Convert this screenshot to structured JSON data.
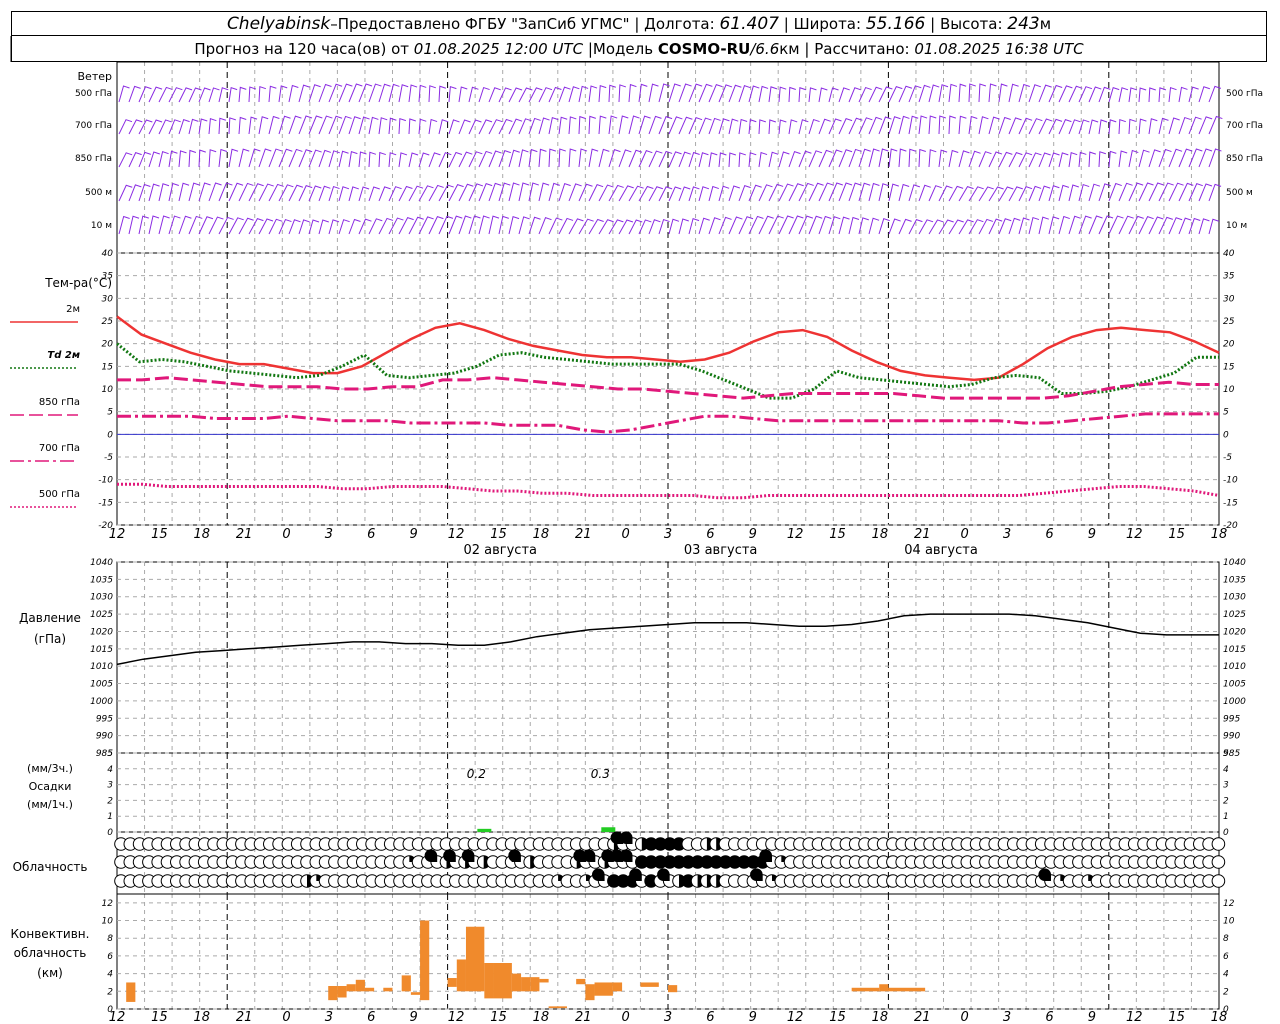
{
  "header": {
    "city": "Chelyabinsk",
    "dash": " – ",
    "provider": "Предоставлено ФГБУ \"ЗапСиб УГМС\"",
    "lon_label": "Долгота:",
    "lon": "61.407",
    "lat_label": "Широта:",
    "lat": "55.166",
    "alt_label": "Высота:",
    "alt": "243",
    "alt_unit": "м",
    "sep": "|"
  },
  "subheader": {
    "forecast_label": "Прогноз на 120 часа(ов) от",
    "issued": "01.08.2025 12:00 UTC",
    "model_label": "Модель",
    "model": "COSMO-RU",
    "slash": " / ",
    "resolution": "6.6",
    "res_unit": "км",
    "computed_label": "Рассчитано:",
    "computed": "01.08.2025 16:38 UTC"
  },
  "colors": {
    "wind": "#8a2be2",
    "t2m": "#ee3333",
    "td2m": "#117711",
    "t850": "#e0187a",
    "t700": "#e0187a",
    "t500": "#e0187a",
    "zero_line": "#3333cc",
    "pressure": "#000000",
    "precip": "#22cc22",
    "conv": "#f08a2c",
    "grid": "#aaaaaa"
  },
  "chart_data": [
    {
      "id": "wind",
      "type": "table",
      "title": "Ветер",
      "levels": [
        "500 гПа",
        "700 гПа",
        "850 гПа",
        "500 м",
        "10  м"
      ]
    },
    {
      "id": "temperature",
      "type": "line",
      "ylabel": "Тем-ра(°С)",
      "ylim": [
        -20,
        40
      ],
      "yticks": [
        -20,
        -15,
        -10,
        -5,
        0,
        5,
        10,
        15,
        20,
        25,
        30,
        35,
        40
      ],
      "x_ticks": [
        "12",
        "15",
        "18",
        "21",
        "0",
        "3",
        "6",
        "9",
        "12",
        "15",
        "18",
        "21",
        "0",
        "3",
        "6",
        "9",
        "12",
        "15",
        "18",
        "21",
        "0",
        "3",
        "6",
        "9",
        "12",
        "15",
        "18"
      ],
      "date_labels": [
        {
          "hour": 45,
          "label": "02 августа"
        },
        {
          "hour": 69,
          "label": "03 августа"
        },
        {
          "hour": 93,
          "label": "04 августа"
        }
      ],
      "x": [
        0,
        1,
        3,
        6,
        9,
        12,
        15,
        18,
        21,
        24,
        27,
        30,
        33,
        36,
        39,
        42,
        45,
        48,
        51,
        54,
        57,
        60,
        63,
        66,
        69,
        72,
        75,
        78,
        81,
        84,
        87,
        90,
        93,
        96,
        99,
        102,
        105,
        108,
        111,
        114,
        117,
        120
      ],
      "series": [
        {
          "name": "2м",
          "key": "t2m",
          "style": "solid",
          "values": [
            26,
            22,
            20,
            18,
            16.5,
            15.5,
            15.5,
            14.5,
            13.5,
            13.5,
            15,
            18,
            21,
            23.5,
            24.5,
            23,
            21,
            19.5,
            18.5,
            17.5,
            17,
            17,
            16.5,
            16,
            16.5,
            18,
            20.5,
            22.5,
            23,
            21.5,
            18.5,
            16,
            14,
            13,
            12.5,
            12,
            12.5,
            15.5,
            19,
            21.5,
            23,
            23.5,
            23,
            22.5,
            20.5,
            18
          ]
        },
        {
          "name": "Td  2м",
          "key": "td2m",
          "style": "dotted",
          "values": [
            20,
            16,
            16.5,
            16,
            15,
            14,
            13.5,
            13,
            12.5,
            13,
            15,
            17.5,
            13,
            12.5,
            13,
            13.5,
            15,
            17.5,
            18,
            17,
            16.5,
            16,
            15.5,
            15.5,
            15.5,
            15.5,
            14,
            12,
            10,
            8,
            8,
            10,
            14,
            12.5,
            12,
            11.5,
            11,
            10.5,
            11,
            12.5,
            13,
            12.5,
            9,
            9,
            9.5,
            10.5,
            12,
            13.5,
            17,
            17
          ]
        },
        {
          "name": "850 гПа",
          "key": "t850",
          "style": "longdash",
          "values": [
            12,
            12,
            12.5,
            12,
            11.5,
            11,
            10.5,
            10.5,
            10.5,
            10,
            10,
            10.5,
            10.5,
            12,
            12,
            12.5,
            12,
            11.5,
            11,
            10.5,
            10,
            10,
            9.5,
            9,
            8.5,
            8,
            8.5,
            9,
            9,
            9,
            9,
            9,
            8.5,
            8,
            8,
            8,
            8,
            8,
            8.5,
            9.5,
            10.5,
            11,
            11.5,
            11,
            11
          ]
        },
        {
          "name": "700 гПа",
          "key": "t700",
          "style": "dashdot",
          "values": [
            4,
            4,
            4,
            4,
            3.5,
            3.5,
            3.5,
            4,
            3.5,
            3,
            3,
            3,
            2.5,
            2.5,
            2.5,
            2.5,
            2,
            2,
            2,
            1,
            0.5,
            1,
            2,
            3,
            4,
            4,
            3.5,
            3,
            3,
            3,
            3,
            3,
            3,
            3,
            3,
            3,
            3,
            2.5,
            2.5,
            3,
            3.5,
            4,
            4.5,
            4.5,
            4.5,
            4.5
          ]
        },
        {
          "name": "500 гПа",
          "key": "t500",
          "style": "dotdense",
          "values": [
            -11,
            -11,
            -11.5,
            -11.5,
            -11.5,
            -11.5,
            -11.5,
            -11.5,
            -11.5,
            -12,
            -12,
            -11.5,
            -11.5,
            -11.5,
            -12,
            -12.5,
            -12.5,
            -13,
            -13,
            -13.5,
            -13.5,
            -13.5,
            -13.5,
            -13.5,
            -14,
            -14,
            -13.5,
            -13.5,
            -13.5,
            -13.5,
            -13.5,
            -13.5,
            -13.5,
            -13.5,
            -13.5,
            -13.5,
            -13.5,
            -13,
            -12.5,
            -12,
            -11.5,
            -11.5,
            -12,
            -12.5,
            -13.5
          ]
        }
      ]
    },
    {
      "id": "pressure",
      "type": "line",
      "ylabel": [
        "Давление",
        "(гПа)"
      ],
      "ylim": [
        985,
        1040
      ],
      "yticks": [
        985,
        990,
        995,
        1000,
        1005,
        1010,
        1015,
        1020,
        1025,
        1030,
        1035,
        1040
      ],
      "x": [
        0,
        3,
        6,
        9,
        12,
        15,
        18,
        21,
        24,
        27,
        30,
        33,
        36,
        39,
        42,
        45,
        48,
        51,
        54,
        57,
        60,
        63,
        66,
        69,
        72,
        75,
        78,
        81,
        84,
        87,
        90,
        93,
        96,
        99,
        102,
        105,
        108,
        111,
        114,
        117,
        120
      ],
      "values": [
        1010.5,
        1012,
        1013,
        1014,
        1014.5,
        1015,
        1015.5,
        1016,
        1016.5,
        1017,
        1017,
        1016.5,
        1016.5,
        1016,
        1016,
        1017,
        1018.5,
        1019.5,
        1020.5,
        1021,
        1021.5,
        1022,
        1022.5,
        1022.5,
        1022.5,
        1022,
        1021.5,
        1021.5,
        1022,
        1023,
        1024.5,
        1025,
        1025,
        1025,
        1025,
        1024.5,
        1023.5,
        1022.5,
        1021,
        1019.5,
        1019,
        1019,
        1019
      ]
    },
    {
      "id": "precip",
      "type": "bar",
      "ylabel": [
        "(мм/3ч.)",
        "Осадки",
        "(мм/1ч.)"
      ],
      "ylim": [
        0,
        5
      ],
      "yticks": [
        0,
        1,
        2,
        3,
        4,
        5
      ],
      "bars": [
        {
          "hour": 40,
          "value": 0.2,
          "label": "0.2"
        },
        {
          "hour": 53.5,
          "value": 0.3,
          "label": "0.3"
        }
      ]
    },
    {
      "id": "cloud",
      "type": "table",
      "ylabel": "Облачность",
      "rows": [
        {
          "level": "high",
          "values": [
            0,
            0,
            0,
            0,
            0,
            0,
            0,
            0,
            0,
            0,
            0,
            0,
            0,
            0,
            0,
            0,
            0,
            0,
            0,
            0,
            0,
            0,
            0,
            0,
            0,
            0,
            0,
            0,
            0,
            0,
            0,
            0,
            0,
            0,
            0,
            0,
            0,
            0,
            0,
            0,
            0,
            0,
            0,
            0,
            0,
            0,
            0,
            0,
            0,
            0,
            0,
            0,
            0,
            2,
            3,
            3,
            2,
            4,
            4,
            4,
            4,
            0,
            0,
            2,
            2,
            0,
            0,
            0,
            0,
            0,
            0,
            0,
            0,
            0,
            0,
            0,
            0,
            0,
            0,
            0,
            0,
            0,
            0,
            0,
            0,
            0,
            0,
            0,
            0,
            0,
            0,
            0,
            0,
            0,
            0,
            0,
            0,
            0,
            0,
            0,
            0,
            0,
            0,
            0,
            0,
            0,
            0,
            0,
            0,
            0,
            0,
            0,
            0,
            0,
            0,
            0,
            0,
            0,
            0,
            0
          ]
        },
        {
          "level": "mid",
          "values": [
            0,
            0,
            0,
            0,
            0,
            0,
            0,
            0,
            0,
            0,
            0,
            0,
            0,
            0,
            0,
            0,
            0,
            0,
            0,
            0,
            0,
            0,
            0,
            0,
            0,
            0,
            0,
            0,
            0,
            0,
            0,
            1,
            0,
            0,
            3,
            2,
            3,
            2,
            3,
            2,
            0,
            0,
            1,
            3,
            2,
            0,
            0,
            0,
            0,
            2,
            3,
            3,
            2,
            3,
            3,
            3,
            4,
            4,
            4,
            4,
            4,
            4,
            4,
            4,
            4,
            4,
            4,
            4,
            4,
            4,
            3,
            1,
            0,
            0,
            0,
            0,
            0,
            0,
            0,
            0,
            0,
            0,
            0,
            0,
            0,
            0,
            0,
            0,
            0,
            0,
            0,
            0,
            0,
            0,
            0,
            0,
            0,
            0,
            0,
            0,
            0,
            0,
            0,
            0,
            0,
            0,
            0,
            0,
            0,
            0,
            0,
            0,
            0,
            0,
            0,
            0,
            0,
            0,
            0,
            0
          ]
        },
        {
          "level": "low",
          "values": [
            0,
            0,
            0,
            0,
            0,
            0,
            0,
            0,
            0,
            0,
            0,
            0,
            0,
            0,
            0,
            0,
            0,
            0,
            0,
            0,
            2,
            1,
            0,
            0,
            0,
            0,
            0,
            0,
            0,
            0,
            0,
            0,
            0,
            0,
            0,
            0,
            0,
            0,
            0,
            0,
            0,
            0,
            0,
            0,
            0,
            0,
            0,
            1,
            0,
            0,
            1,
            0,
            3,
            4,
            4,
            4,
            3,
            4,
            0,
            3,
            2,
            4,
            2,
            2,
            2,
            0,
            0,
            0,
            0,
            3,
            1,
            0,
            0,
            0,
            0,
            0,
            0,
            0,
            0,
            0,
            0,
            0,
            0,
            0,
            0,
            0,
            0,
            0,
            0,
            0,
            0,
            0,
            0,
            0,
            0,
            0,
            0,
            0,
            0,
            0,
            3,
            1,
            0,
            0,
            1,
            0,
            0,
            0,
            0,
            0,
            0,
            0,
            0,
            0,
            0,
            0,
            0,
            0,
            0,
            0
          ]
        }
      ]
    },
    {
      "id": "convective",
      "type": "bar",
      "ylabel": [
        "Конвективн.",
        "облачность",
        "(км)"
      ],
      "ylim": [
        0,
        13
      ],
      "yticks": [
        0,
        2,
        4,
        6,
        8,
        10,
        12
      ],
      "bars": [
        {
          "h0": 1,
          "h1": 2,
          "base": 0.8,
          "top": 3
        },
        {
          "h0": 23,
          "h1": 24,
          "base": 1,
          "top": 2.6
        },
        {
          "h0": 24,
          "h1": 25,
          "base": 1.3,
          "top": 2.6
        },
        {
          "h0": 25,
          "h1": 26,
          "base": 2,
          "top": 2.8
        },
        {
          "h0": 26,
          "h1": 27,
          "base": 2,
          "top": 3.3
        },
        {
          "h0": 27,
          "h1": 28,
          "base": 2,
          "top": 2.4
        },
        {
          "h0": 29,
          "h1": 30,
          "base": 2,
          "top": 2.4
        },
        {
          "h0": 31,
          "h1": 32,
          "base": 2,
          "top": 3.8
        },
        {
          "h0": 32,
          "h1": 33,
          "base": 1.6,
          "top": 1.9
        },
        {
          "h0": 33,
          "h1": 34,
          "base": 1,
          "top": 10
        },
        {
          "h0": 36,
          "h1": 37,
          "base": 2.5,
          "top": 3.5
        },
        {
          "h0": 37,
          "h1": 38,
          "base": 2,
          "top": 5.6
        },
        {
          "h0": 38,
          "h1": 40,
          "base": 2,
          "top": 9.3
        },
        {
          "h0": 40,
          "h1": 41,
          "base": 1.2,
          "top": 5.2
        },
        {
          "h0": 41,
          "h1": 43,
          "base": 1.2,
          "top": 5.2
        },
        {
          "h0": 43,
          "h1": 44,
          "base": 2,
          "top": 4
        },
        {
          "h0": 44,
          "h1": 45,
          "base": 2,
          "top": 3.6
        },
        {
          "h0": 45,
          "h1": 46,
          "base": 2,
          "top": 3.6
        },
        {
          "h0": 46,
          "h1": 47,
          "base": 3,
          "top": 3.4
        },
        {
          "h0": 47,
          "h1": 49,
          "base": 0.1,
          "top": 0.3
        },
        {
          "h0": 50,
          "h1": 51,
          "base": 2.8,
          "top": 3.4
        },
        {
          "h0": 51,
          "h1": 52,
          "base": 1,
          "top": 2.8
        },
        {
          "h0": 52,
          "h1": 54,
          "base": 1.5,
          "top": 3
        },
        {
          "h0": 54,
          "h1": 55,
          "base": 2,
          "top": 3
        },
        {
          "h0": 57,
          "h1": 59,
          "base": 2.5,
          "top": 3
        },
        {
          "h0": 60,
          "h1": 61,
          "base": 1.9,
          "top": 2.7
        },
        {
          "h0": 80,
          "h1": 83,
          "base": 2,
          "top": 2.4
        },
        {
          "h0": 83,
          "h1": 84,
          "base": 2,
          "top": 2.8
        },
        {
          "h0": 84,
          "h1": 88,
          "base": 2,
          "top": 2.4
        }
      ]
    }
  ]
}
